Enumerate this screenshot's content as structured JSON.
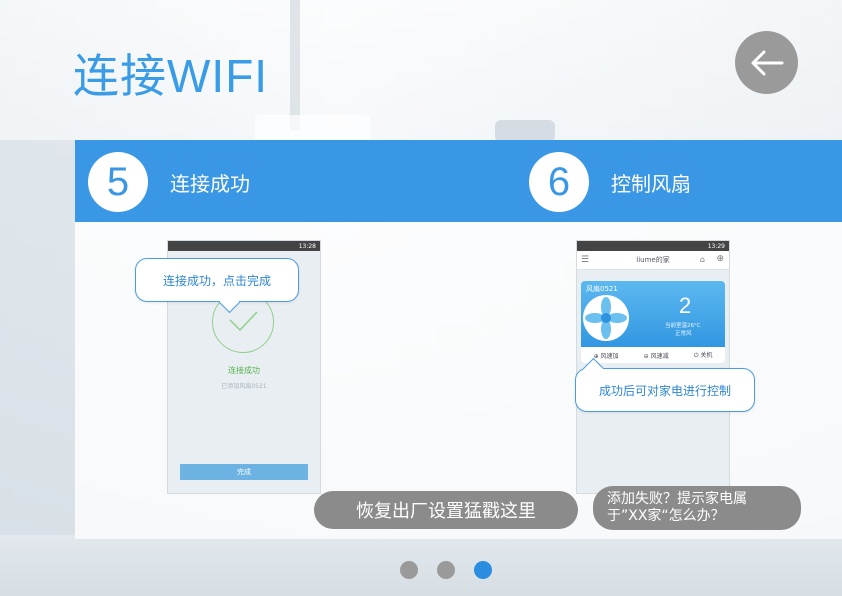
{
  "title": "连接WIFI",
  "steps": [
    {
      "number": "5",
      "label": "连接成功"
    },
    {
      "number": "6",
      "label": "控制风扇"
    }
  ],
  "phone1": {
    "status_time": "13:28",
    "success_text": "连接成功",
    "added_text": "已添加风扇0521",
    "done_button": "完成"
  },
  "phone2": {
    "status_time": "13:29",
    "header_title": "liume的家",
    "fan_name": "风扇0521",
    "fan_number": "2",
    "fan_temp": "当前室温26°C",
    "fan_mode": "正常风",
    "controls": [
      "风速加",
      "风速减",
      "关机"
    ]
  },
  "bubbles": {
    "step5": "连接成功，点击完成",
    "step6": "成功后可对家电进行控制"
  },
  "buttons": {
    "reset": "恢复出厂设置猛戳这里",
    "help": "添加失败？提示家电属于”XX家“怎么办？"
  },
  "pagination": {
    "total": 3,
    "active": 3
  },
  "colors": {
    "accent": "#3a97e5",
    "title": "#3a9ce6",
    "pill": "#8b8b8b",
    "dot_active": "#2a8de0",
    "dot_inactive": "#9a9a9a"
  }
}
